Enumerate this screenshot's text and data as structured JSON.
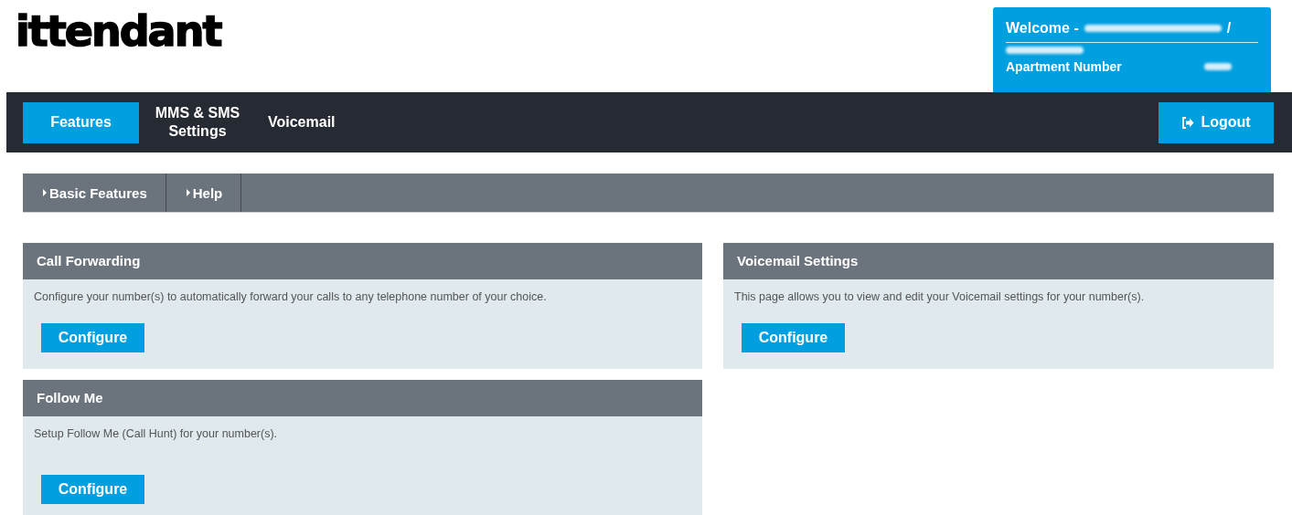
{
  "logo": "ittendant",
  "user_box": {
    "welcome": "Welcome -",
    "separator": "/",
    "apartment_label": "Apartment Number"
  },
  "nav": {
    "tabs": [
      {
        "label": "Features",
        "selected": true
      },
      {
        "label": "MMS & SMS Settings",
        "selected": false
      },
      {
        "label": "Voicemail",
        "selected": false
      }
    ],
    "logout": "Logout"
  },
  "subnav": [
    "Basic Features",
    "Help"
  ],
  "columns": [
    [
      {
        "title": "Call Forwarding",
        "description": "Configure your number(s) to automatically forward your calls to any telephone number of your choice.",
        "button": "Configure"
      },
      {
        "title": "Follow Me",
        "description": "Setup Follow Me (Call Hunt) for your number(s).",
        "button": "Configure"
      }
    ],
    [
      {
        "title": "Voicemail Settings",
        "description": "This page allows you to view and edit your Voicemail settings for your number(s).",
        "button": "Configure"
      }
    ]
  ]
}
